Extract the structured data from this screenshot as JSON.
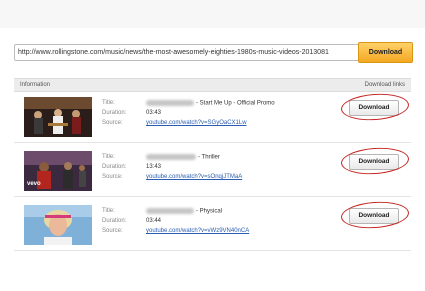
{
  "search": {
    "url_value": "http://www.rollingstone.com/music/news/the-most-awesomely-eighties-1980s-music-videos-2013081",
    "download_label": "Download"
  },
  "table": {
    "col_info": "Information",
    "col_links": "Download links"
  },
  "labels": {
    "title": "Title:",
    "duration": "Duration:",
    "source": "Source:"
  },
  "results": [
    {
      "title_suffix": "- Start Me Up - Official Promo",
      "duration": "03:43",
      "source": "youtube.com/watch?v=SGyOaCX1Lw",
      "button": "Download"
    },
    {
      "title_suffix": "- Thriller",
      "duration": "13:43",
      "source": "youtube.com/watch?v=sOnqjJTMaA",
      "button": "Download",
      "thumb_badge": "vevo"
    },
    {
      "title_suffix": "- Physical",
      "duration": "03:44",
      "source": "youtube.com/watch?v=vWz9VN40nCA",
      "button": "Download"
    }
  ],
  "colors": {
    "accent_orange": "#f4a823",
    "annotation_red": "#c2241f",
    "link_blue": "#2a5db0"
  }
}
